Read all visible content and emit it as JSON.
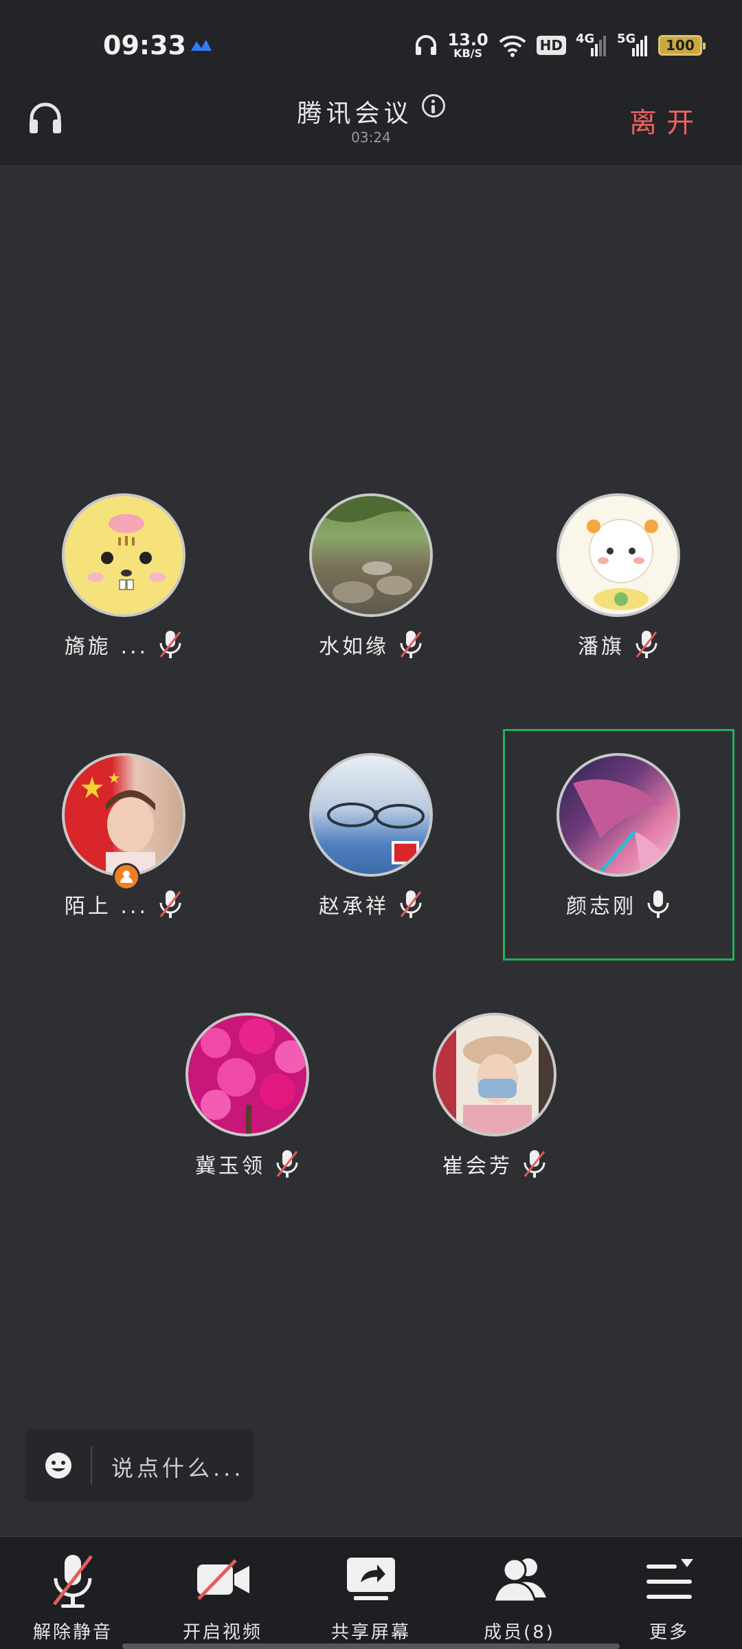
{
  "status_bar": {
    "time": "09:33",
    "network_speed": "13.0",
    "network_speed_unit": "KB/S",
    "hd_label": "HD",
    "net_4g": "4G",
    "net_5g": "5G",
    "battery": "100",
    "icons": [
      "app-notification-icon",
      "headphones-icon",
      "wifi-icon",
      "signal-icon",
      "battery-icon"
    ]
  },
  "header": {
    "title": "腾讯会议",
    "duration": "03:24",
    "leave_label": "离开",
    "leave_color": "#f06262",
    "icons": [
      "headphones-icon",
      "info-icon"
    ]
  },
  "participants": [
    {
      "name": "旖旎 ...",
      "mic": "muted"
    },
    {
      "name": "水如缘",
      "mic": "muted"
    },
    {
      "name": "潘旗",
      "mic": "muted"
    },
    {
      "name": "陌上 ...",
      "mic": "muted",
      "badge": "host"
    },
    {
      "name": "赵承祥",
      "mic": "muted"
    },
    {
      "name": "颜志刚",
      "mic": "on",
      "speaking": true
    },
    {
      "name": "冀玉领",
      "mic": "muted"
    },
    {
      "name": "崔会芳",
      "mic": "muted"
    }
  ],
  "active_speaker_color": "#22b05a",
  "chat": {
    "placeholder": "说点什么..."
  },
  "toolbar": {
    "items": [
      {
        "label": "解除静音",
        "icon": "mic-muted-icon"
      },
      {
        "label": "开启视频",
        "icon": "video-off-icon"
      },
      {
        "label": "共享屏幕",
        "icon": "share-screen-icon"
      },
      {
        "label": "成员(8)",
        "icon": "members-icon"
      },
      {
        "label": "更多",
        "icon": "more-menu-icon"
      }
    ]
  }
}
